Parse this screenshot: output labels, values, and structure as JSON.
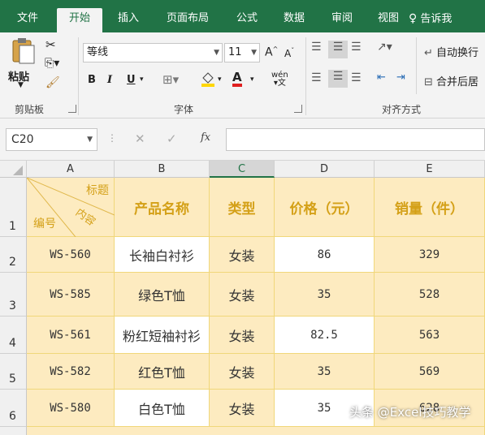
{
  "tabs": [
    {
      "label": "文件",
      "active": false
    },
    {
      "label": "开始",
      "active": true
    },
    {
      "label": "插入",
      "active": false
    },
    {
      "label": "页面布局",
      "active": false
    },
    {
      "label": "公式",
      "active": false
    },
    {
      "label": "数据",
      "active": false
    },
    {
      "label": "审阅",
      "active": false
    },
    {
      "label": "视图",
      "active": false
    }
  ],
  "tell_me": "告诉我",
  "ribbon": {
    "paste_label": "粘贴",
    "clipboard_label": "剪贴板",
    "font_name": "等线",
    "font_size": "11",
    "grow_font": "A",
    "shrink_font": "A",
    "bold": "B",
    "italic": "I",
    "underline": "U",
    "font_color_glyph": "A",
    "phonetic": "wén",
    "font_group_label": "字体",
    "wrap_text": "自动换行",
    "merge_center": "合并后居",
    "alignment_group_label": "对齐方式"
  },
  "formula_bar": {
    "name_box": "C20",
    "fx": "fx",
    "content": ""
  },
  "columns": [
    "A",
    "B",
    "C",
    "D",
    "E"
  ],
  "selected_column": "C",
  "header_row": {
    "row_num": "1",
    "diag_top": "标题",
    "diag_mid": "内容",
    "diag_bottom": "编号",
    "b": "产品名称",
    "c": "类型",
    "d": "价格（元）",
    "e": "销量（件）"
  },
  "rows": [
    {
      "num": "2",
      "a": "WS-560",
      "b": "长袖白衬衫",
      "c": "女装",
      "d": "86",
      "e": "329"
    },
    {
      "num": "3",
      "a": "WS-585",
      "b": "绿色T恤",
      "c": "女装",
      "d": "35",
      "e": "528"
    },
    {
      "num": "4",
      "a": "WS-561",
      "b": "粉红短袖衬衫",
      "c": "女装",
      "d": "82.5",
      "e": "563"
    },
    {
      "num": "5",
      "a": "WS-582",
      "b": "红色T恤",
      "c": "女装",
      "d": "35",
      "e": "569"
    },
    {
      "num": "6",
      "a": "WS-580",
      "b": "白色T恤",
      "c": "女装",
      "d": "35",
      "e": "628"
    }
  ],
  "watermark": "头条 @Excel技巧教学",
  "colors": {
    "accent": "#217346",
    "cell_fill": "#fdebc0",
    "header_text": "#d4a017",
    "border": "#f0d77a"
  }
}
